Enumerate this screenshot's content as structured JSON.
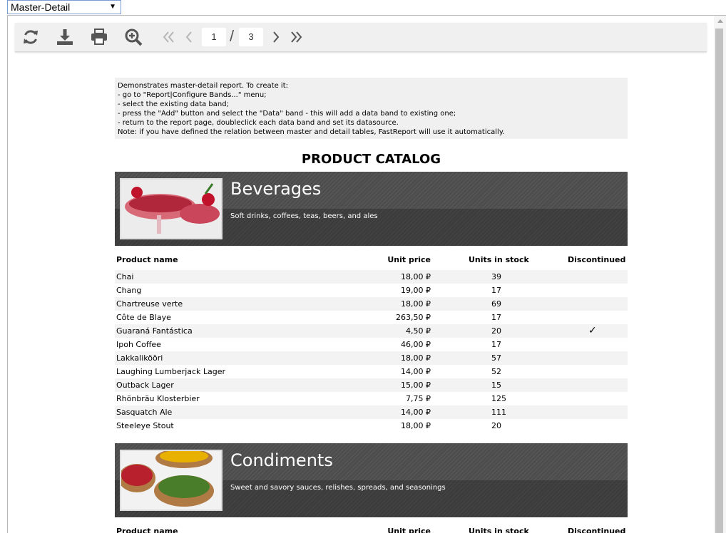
{
  "report_select": {
    "value": "Master-Detail"
  },
  "toolbar": {
    "refresh_icon": "refresh-icon",
    "download_icon": "download-icon",
    "print_icon": "print-icon",
    "zoom_icon": "zoom-in-icon",
    "current_page": "1",
    "page_separator": "/",
    "total_pages": "3"
  },
  "report": {
    "note": "Demonstrates master-detail report. To create it:\n- go to \"Report|Configure Bands...\" menu;\n- select the existing data band;\n- press the \"Add\" button and select the \"Data\" band - this will add a data band to existing one;\n- return to the report page, doubleclick each data band and set its datasource.\nNote: if you have defined the relation between master and detail tables, FastReport will use it automatically.",
    "title": "PRODUCT CATALOG",
    "columns": {
      "name": "Product name",
      "price": "Unit price",
      "stock": "Units in stock",
      "discontinued": "Discontinued"
    },
    "categories": [
      {
        "name": "Beverages",
        "description": "Soft drinks, coffees, teas, beers, and ales",
        "products": [
          {
            "name": "Chai",
            "price": "18,00 ₽",
            "stock": "39",
            "discontinued": ""
          },
          {
            "name": "Chang",
            "price": "19,00 ₽",
            "stock": "17",
            "discontinued": ""
          },
          {
            "name": "Chartreuse verte",
            "price": "18,00 ₽",
            "stock": "69",
            "discontinued": ""
          },
          {
            "name": "Côte de Blaye",
            "price": "263,50 ₽",
            "stock": "17",
            "discontinued": ""
          },
          {
            "name": "Guaraná Fantástica",
            "price": "4,50 ₽",
            "stock": "20",
            "discontinued": "✓"
          },
          {
            "name": "Ipoh Coffee",
            "price": "46,00 ₽",
            "stock": "17",
            "discontinued": ""
          },
          {
            "name": "Lakkalikööri",
            "price": "18,00 ₽",
            "stock": "57",
            "discontinued": ""
          },
          {
            "name": "Laughing Lumberjack Lager",
            "price": "14,00 ₽",
            "stock": "52",
            "discontinued": ""
          },
          {
            "name": "Outback Lager",
            "price": "15,00 ₽",
            "stock": "15",
            "discontinued": ""
          },
          {
            "name": "Rhönbräu Klosterbier",
            "price": "7,75 ₽",
            "stock": "125",
            "discontinued": ""
          },
          {
            "name": "Sasquatch Ale",
            "price": "14,00 ₽",
            "stock": "111",
            "discontinued": ""
          },
          {
            "name": "Steeleye Stout",
            "price": "18,00 ₽",
            "stock": "20",
            "discontinued": ""
          }
        ]
      },
      {
        "name": "Condiments",
        "description": "Sweet and savory sauces, relishes, spreads, and seasonings",
        "products": []
      }
    ]
  }
}
